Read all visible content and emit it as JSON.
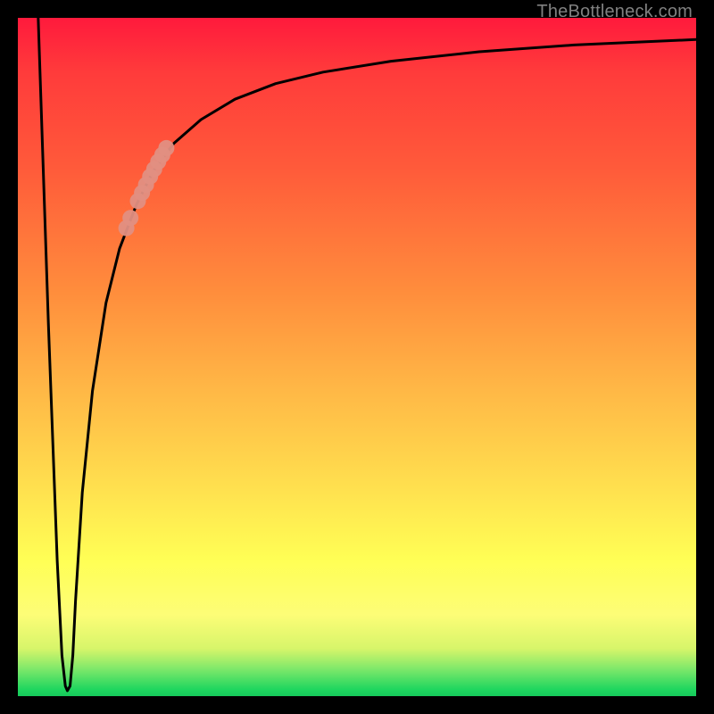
{
  "watermark": "TheBottleneck.com",
  "colors": {
    "frame": "#000000",
    "curve": "#000000",
    "marker": "#e28f82",
    "gradient_top": "#ff1a3c",
    "gradient_mid1": "#ff8c3c",
    "gradient_mid2": "#ffe24f",
    "gradient_mid3": "#ffff55",
    "gradient_bottom": "#16c95b"
  },
  "chart_data": {
    "type": "line",
    "title": "",
    "xlabel": "",
    "ylabel": "",
    "xlim": [
      0,
      100
    ],
    "ylim": [
      0,
      100
    ],
    "grid": false,
    "note": "Axes are unlabeled in the source image; values are positional estimates (0–100) of the black curve within the plot box.",
    "series": [
      {
        "name": "curve",
        "x": [
          3.0,
          4.5,
          5.8,
          6.5,
          7.0,
          7.3,
          7.7,
          8.1,
          8.5,
          9.5,
          11.0,
          13.0,
          15.0,
          17.5,
          20.0,
          23.0,
          27.0,
          32.0,
          38.0,
          45.0,
          55.0,
          68.0,
          82.0,
          100.0
        ],
        "y": [
          100.0,
          55.0,
          20.0,
          6.0,
          1.5,
          0.8,
          1.5,
          6.0,
          14.0,
          30.0,
          45.0,
          58.0,
          66.0,
          72.5,
          77.5,
          81.5,
          85.0,
          88.0,
          90.3,
          92.0,
          93.6,
          95.0,
          96.0,
          96.8
        ]
      }
    ],
    "markers": [
      {
        "name": "highlight-dot",
        "x": 16.0,
        "y": 69.0
      },
      {
        "name": "highlight-dot",
        "x": 16.6,
        "y": 70.5
      },
      {
        "name": "highlight-dot",
        "x": 17.7,
        "y": 73.0
      },
      {
        "name": "highlight-dot",
        "x": 18.3,
        "y": 74.2
      },
      {
        "name": "highlight-dot",
        "x": 18.9,
        "y": 75.4
      },
      {
        "name": "highlight-dot",
        "x": 19.5,
        "y": 76.6
      },
      {
        "name": "highlight-dot",
        "x": 20.1,
        "y": 77.7
      },
      {
        "name": "highlight-dot",
        "x": 20.7,
        "y": 78.8
      },
      {
        "name": "highlight-dot",
        "x": 21.3,
        "y": 79.8
      },
      {
        "name": "highlight-dot",
        "x": 21.9,
        "y": 80.8
      }
    ]
  }
}
